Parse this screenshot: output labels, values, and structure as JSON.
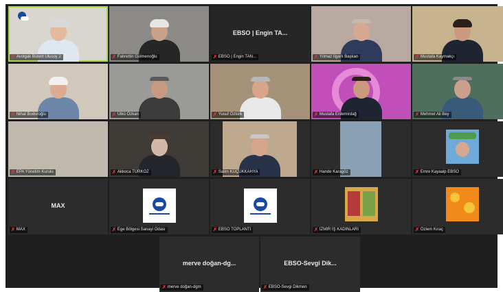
{
  "participants": [
    {
      "name": "Avolgak Bülent Ulusoy 2",
      "display_text": ""
    },
    {
      "name": "Fahrettin Gülmenoğlu",
      "display_text": ""
    },
    {
      "name": "EBSO | Engin TAN...",
      "display_text": "EBSO | Engin TA..."
    },
    {
      "name": "Yılmaz İlgarlı Başkan",
      "display_text": ""
    },
    {
      "name": "Mustafa Kaymakçı",
      "display_text": ""
    },
    {
      "name": "Nihat Boduroğlu",
      "display_text": ""
    },
    {
      "name": "Ülkü Özkan",
      "display_text": ""
    },
    {
      "name": "Yusuf Öztürk",
      "display_text": ""
    },
    {
      "name": "Mustafa Erdemirdağ",
      "display_text": ""
    },
    {
      "name": "Mehmet Ali Bey",
      "display_text": ""
    },
    {
      "name": "EPA Yönetim Kurulu",
      "display_text": ""
    },
    {
      "name": "Akkoca TÜRKÖZ",
      "display_text": ""
    },
    {
      "name": "Salim KÜÇÜKKAHYA",
      "display_text": ""
    },
    {
      "name": "Hande Karagöz",
      "display_text": ""
    },
    {
      "name": "Emre Kayaalp EBSO",
      "display_text": ""
    },
    {
      "name": "MAX",
      "display_text": "MAX"
    },
    {
      "name": "Ege Bölgesi Sanayi Odası",
      "display_text": ""
    },
    {
      "name": "EBSO TOPLANTI",
      "display_text": ""
    },
    {
      "name": "İZMİR İŞ KADINLARI",
      "display_text": ""
    },
    {
      "name": "Özlem Kıraç",
      "display_text": ""
    },
    {
      "name": "merve doğan-dgm",
      "display_text": "merve doğan-dg..."
    },
    {
      "name": "EBSO-Sevgi Dikmen",
      "display_text": "EBSO-Sevgi Dik..."
    }
  ],
  "colors": {
    "background": "#1f1f1f",
    "tile": "#2c2c2c",
    "active_speaker_border": "#a6d84a",
    "muted_icon": "#e0393e"
  },
  "icons": {
    "muted": "mic-muted-icon"
  }
}
